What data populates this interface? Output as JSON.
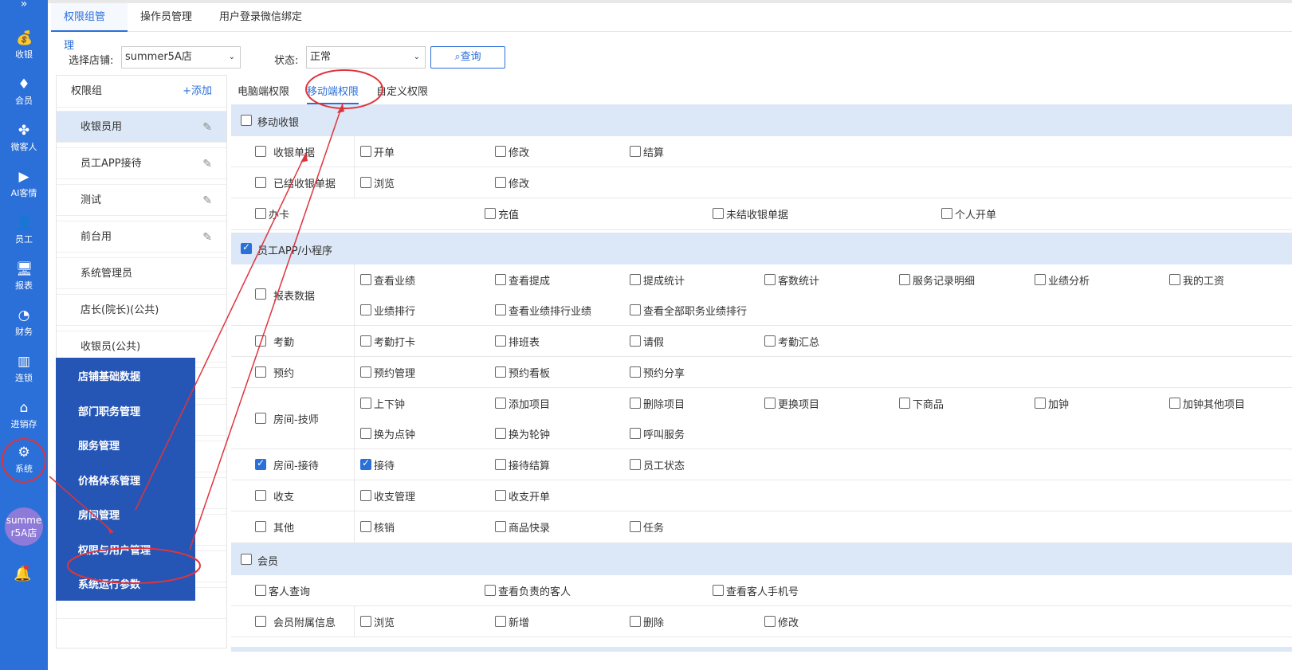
{
  "sidebar": {
    "top": "»",
    "items": [
      {
        "label": "收银",
        "icon": "money-bag-icon",
        "glyph": "💰"
      },
      {
        "label": "会员",
        "icon": "diamond-icon",
        "glyph": "♦"
      },
      {
        "label": "微客人",
        "icon": "clover-icon",
        "glyph": "✤"
      },
      {
        "label": "AI客情",
        "icon": "play-icon",
        "glyph": "▶"
      },
      {
        "label": "员工",
        "icon": "user-icon",
        "glyph": "👤"
      },
      {
        "label": "报表",
        "icon": "monitor-icon",
        "glyph": "🖥"
      },
      {
        "label": "财务",
        "icon": "pie-chart-icon",
        "glyph": "◔"
      },
      {
        "label": "连锁",
        "icon": "store-icon",
        "glyph": "▥"
      },
      {
        "label": "进销存",
        "icon": "home-icon",
        "glyph": "⌂"
      },
      {
        "label": "系统",
        "icon": "gear-icon",
        "glyph": "⚙"
      }
    ],
    "store_line1": "summe",
    "store_line2": "r5A店",
    "bell": "🔔"
  },
  "tabs": [
    "权限组管理",
    "操作员管理",
    "用户登录微信绑定"
  ],
  "filters": {
    "store_label": "选择店铺:",
    "store_value": "summer5A店",
    "status_label": "状态:",
    "status_value": "正常",
    "query_label": "查询"
  },
  "group_panel": {
    "title": "权限组",
    "add": "+添加",
    "items": [
      "收银员用",
      "员工APP接待",
      "测试",
      "前台用",
      "系统管理员",
      "店长(院长)(公共)",
      "收银员(公共)"
    ],
    "partial_item": " "
  },
  "popup_menu": [
    "店铺基础数据",
    "部门职务管理",
    "服务管理",
    "价格体系管理",
    "房间管理",
    "权限与用户管理",
    "系统运行参数"
  ],
  "perm_tabs": [
    "电脑端权限",
    "移动端权限",
    "自定义权限"
  ],
  "sections": [
    {
      "title": "移动收银",
      "checked": false
    },
    {
      "title": "员工APP/小程序",
      "checked": true
    },
    {
      "title": "会员",
      "checked": false
    }
  ],
  "rows": {
    "r1": {
      "label": "收银单据",
      "opts": [
        "开单",
        "修改",
        "结算"
      ]
    },
    "r2": {
      "label": "已结收银单据",
      "opts": [
        "浏览",
        "修改"
      ]
    },
    "r3": {
      "opts": [
        "办卡",
        "充值",
        "未结收银单据",
        "个人开单"
      ]
    },
    "r4": {
      "label": "报表数据",
      "opts": [
        "查看业绩",
        "查看提成",
        "提成统计",
        "客数统计",
        "服务记录明细",
        "业绩分析",
        "我的工资",
        "业绩排行",
        "查看业绩排行业绩",
        "查看全部职务业绩排行"
      ]
    },
    "r5": {
      "label": "考勤",
      "opts": [
        "考勤打卡",
        "排班表",
        "请假",
        "考勤汇总"
      ]
    },
    "r6": {
      "label": "预约",
      "opts": [
        "预约管理",
        "预约看板",
        "预约分享"
      ]
    },
    "r7": {
      "label": "房间-技师",
      "opts": [
        "上下钟",
        "添加项目",
        "删除项目",
        "更换项目",
        "下商品",
        "加钟",
        "加钟其他项目",
        "换为点钟",
        "换为轮钟",
        "呼叫服务"
      ]
    },
    "r8": {
      "label": "房间-接待",
      "opts": [
        "接待",
        "接待结算",
        "员工状态"
      ]
    },
    "r9": {
      "label": "收支",
      "opts": [
        "收支管理",
        "收支开单"
      ]
    },
    "r10": {
      "label": "其他",
      "opts": [
        "核销",
        "商品快录",
        "任务"
      ]
    },
    "r11": {
      "opts": [
        "客人查询",
        "查看负责的客人",
        "查看客人手机号"
      ]
    },
    "r12": {
      "label": "会员附属信息",
      "opts": [
        "浏览",
        "新增",
        "删除",
        "修改"
      ]
    }
  },
  "colors": {
    "accent": "#2b6fd9",
    "sidebar": "#2b6fd9",
    "popup": "#2556b6",
    "annotation": "#e0343c",
    "section": "#dce8f7"
  }
}
